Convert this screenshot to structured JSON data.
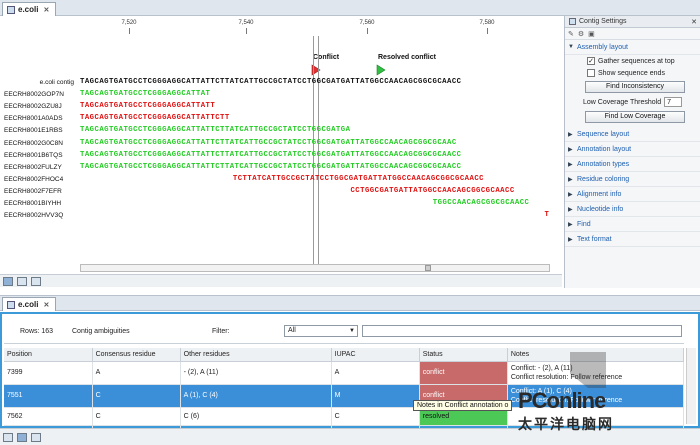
{
  "tabs": {
    "main": "e.coli",
    "table": "e.coli"
  },
  "ruler": {
    "ticks": [
      {
        "label": "7,520"
      },
      {
        "label": "7,540"
      },
      {
        "label": "7,560"
      },
      {
        "label": "7,580"
      }
    ]
  },
  "annotations": {
    "conflict": "Conflict",
    "resolved": "Resolved conflict"
  },
  "contig": {
    "name": "e.coli contig",
    "sequence": "TAGCAGTGATGCCTCGGGAGGCATTATTCTTATCATTGCCGCTATCCTGGCGATGATTATGGCCAACAGCGGCGCAACC",
    "reads": [
      {
        "name": "EECRH8002GOP7N",
        "seq": "TAGCAGTGATGCCTCGGGAGGCATTAT",
        "color": "g",
        "offset": 0
      },
      {
        "name": "EECRH8002GZU8J",
        "seq": "TAGCAGTGATGCCTCGGGAGGCATTATT",
        "color": "r",
        "offset": 0
      },
      {
        "name": "EECRH8001A0ADS",
        "seq": "TAGCAGTGATGCCTCGGGAGGCATTATTCTT",
        "color": "r",
        "offset": 0
      },
      {
        "name": "EECRH8001E1RBS",
        "seq": "TAGCAGTGATGCCTCGGGAGGCATTATTCTTATCATTGCCGCTATCCTGGCGATGA",
        "color": "g",
        "offset": 0
      },
      {
        "name": "EECRH8002G0C8N",
        "seq": "TAGCAGTGATGCCTCGGGAGGCATTATTCTTATCATTGCCGCTATCCTGGCGATGATTATGGCCAACAGCGGCGCAAC",
        "color": "g",
        "offset": 0
      },
      {
        "name": "EECRH8001B6TQS",
        "seq": "TAGCAGTGATGCCTCGGGAGGCATTATTCTTATCATTGCCGCTATCCTGGCGATGATTATGGCCAACAGCGGCGCAACC",
        "color": "g",
        "offset": 0
      },
      {
        "name": "EECRH8002FULZY",
        "seq": "TAGCAGTGATGCCTCGGGAGGCATTATTCTTATCATTGCCGCTATCCTGGCGATGATTATGGCCAACAGCGGCGCAACC",
        "color": "g",
        "offset": 0
      },
      {
        "name": "EECRH8002FHOC4",
        "seq": "TCTTATCATTGCCGCTATCCTGGCGATGATTATGGCCAACAGCGGCGCAACC",
        "color": "r",
        "offset": 26
      },
      {
        "name": "EECRH8002F7EFR",
        "seq": "CCTGGCGATGATTATGGCCAACAGCGGCGCAACC",
        "color": "r",
        "offset": 46
      },
      {
        "name": "EECRH8001BIYHH",
        "seq": "TGGCCAACAGCGGCGCAACC",
        "color": "g",
        "offset": 60
      },
      {
        "name": "EECRH8002HVV3Q",
        "seq": "T",
        "color": "r",
        "offset": 79
      }
    ]
  },
  "settings": {
    "title": "Contig Settings",
    "sections": {
      "assembly_layout": "Assembly layout",
      "sequence_layout": "Sequence layout",
      "annotation_layout": "Annotation layout",
      "annotation_types": "Annotation types",
      "residue_coloring": "Residue coloring",
      "alignment_info": "Alignment info",
      "nucleotide_info": "Nucleotide info",
      "find": "Find",
      "text_format": "Text format"
    },
    "gather_label": "Gather sequences at top",
    "gather_checked": true,
    "show_ends_label": "Show sequence ends",
    "show_ends_checked": false,
    "find_inconsistency": "Find Inconsistency",
    "threshold_label": "Low Coverage Threshold",
    "threshold_value": "7",
    "find_low_coverage": "Find Low Coverage"
  },
  "table": {
    "rows_label": "Rows: 163",
    "title": "Contig ambiguities",
    "filter_label": "Filter:",
    "filter_value": "All",
    "columns": [
      "Position",
      "Consensus residue",
      "Other residues",
      "IUPAC",
      "Status",
      "Notes"
    ],
    "rows": [
      {
        "position": "7399",
        "consensus": "A",
        "other": "- (2), A (11)",
        "iupac": "A",
        "status": "conflict",
        "notes": [
          "Conflict: - (2), A (11)",
          "Conflict resolution: Follow reference"
        ],
        "selected": false
      },
      {
        "position": "7551",
        "consensus": "C",
        "other": "A (1), C (4)",
        "iupac": "M",
        "status": "conflict",
        "notes": [
          "Conflict: A (1), C (4)",
          "Conflict resolution: Follow reference"
        ],
        "selected": true
      },
      {
        "position": "7562",
        "consensus": "C",
        "other": "C (6)",
        "iupac": "C",
        "status": "resolved",
        "notes": [
          "",
          ""
        ],
        "selected": false
      },
      {
        "position": "",
        "consensus": "",
        "other": "",
        "iupac": "",
        "status": "",
        "notes": [
          "Conflict: - (1), G (4)",
          ""
        ],
        "selected": false
      }
    ],
    "tooltip": "Notes in Conflict annotation o"
  },
  "watermark": {
    "brand": "PConline",
    "sub": "太平洋电脑网"
  },
  "colors": {
    "accent": "#3d9ad8",
    "conflict": "#c96a6a",
    "resolved": "#4cc856",
    "read_forward": "#22cc22",
    "read_reverse": "#e01010"
  }
}
